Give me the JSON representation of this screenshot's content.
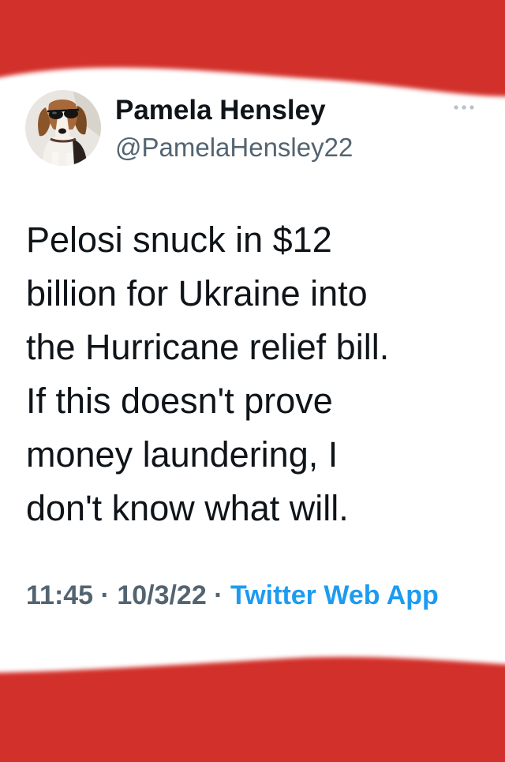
{
  "colors": {
    "frame_red": "#d2302a",
    "text": "#0f1419",
    "secondary": "#536471",
    "link": "#1d9bf0"
  },
  "tweet": {
    "author": {
      "name": "Pamela Hensley",
      "handle": "@PamelaHensley22",
      "avatar_icon": "beagle-with-sunglasses-avatar"
    },
    "more_icon": "more-options-icon",
    "text_lines": [
      "Pelosi snuck in $12",
      "billion for Ukraine into",
      "the Hurricane relief bill.",
      "If this doesn't prove",
      "money laundering, I",
      "don't know what will."
    ],
    "time": "11:45",
    "date": "10/3/22",
    "separator": " · ",
    "source": "Twitter Web App"
  }
}
